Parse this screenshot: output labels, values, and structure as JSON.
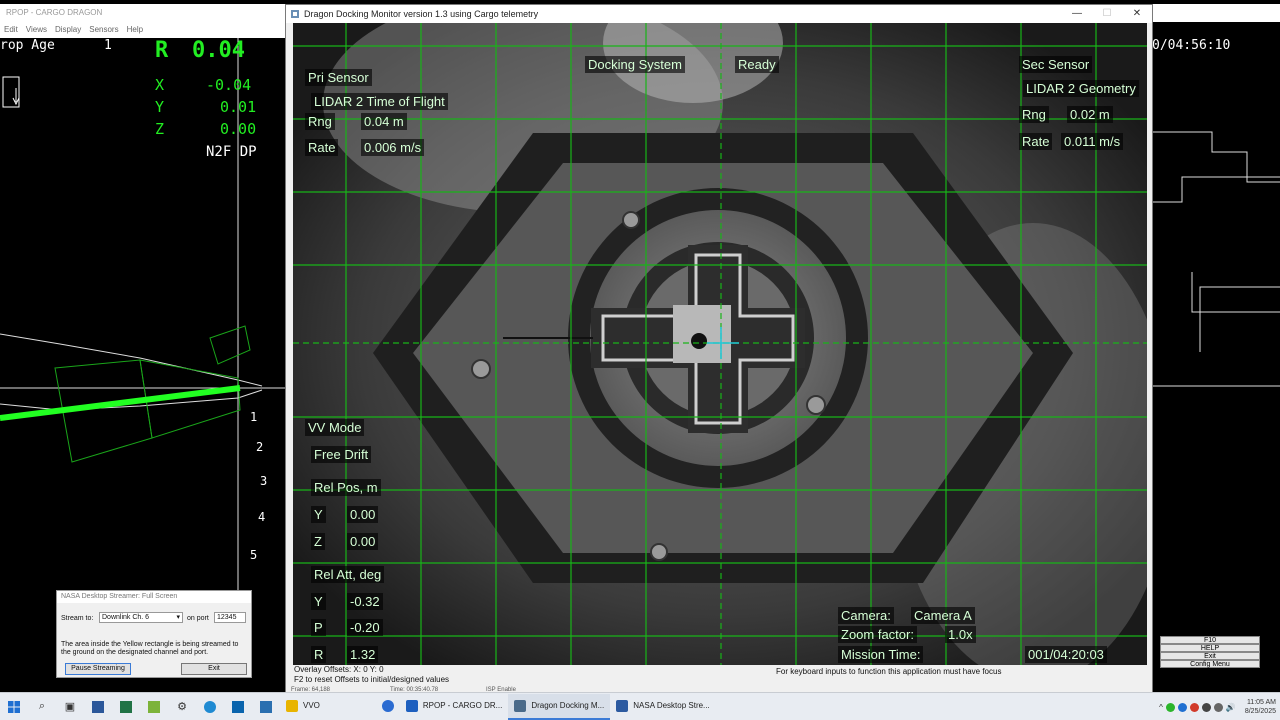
{
  "rpop": {
    "title": "RPOP - CARGO DRAGON",
    "menu": [
      "Edit",
      "Views",
      "Display",
      "Sensors",
      "Help"
    ],
    "prop_age_label": "rop Age",
    "prop_age_value": "1",
    "r_label": "R",
    "r_value": "0.04",
    "x_label": "X",
    "x_value": "-0.04",
    "y_label": "Y",
    "y_value": "0.01",
    "z_label": "Z",
    "z_value": "0.00",
    "mode": "N2F DP",
    "axis_ticks": [
      "1",
      "2",
      "3",
      "4",
      "5"
    ]
  },
  "right_panel": {
    "time": "0/04:56:10",
    "fkeys": [
      "F10",
      "HELP",
      "Exit",
      "Config Menu"
    ]
  },
  "window": {
    "title": "Dragon Docking Monitor version 1.3 using Cargo telemetry",
    "controls": [
      "—",
      "☐",
      "✕"
    ]
  },
  "overlay": {
    "pri_sensor_label": "Pri Sensor",
    "pri_sensor_value": "LIDAR 2 Time of Flight",
    "pri_rng_label": "Rng",
    "pri_rng_value": "0.04 m",
    "pri_rate_label": "Rate",
    "pri_rate_value": "0.006 m/s",
    "docking_system_label": "Docking System",
    "docking_system_value": "Ready",
    "sec_sensor_label": "Sec Sensor",
    "sec_sensor_value": "LIDAR 2 Geometry",
    "sec_rng_label": "Rng",
    "sec_rng_value": "0.02 m",
    "sec_rate_label": "Rate",
    "sec_rate_value": "0.011 m/s",
    "vv_mode_label": "VV Mode",
    "vv_mode_value": "Free Drift",
    "rel_pos_label": "Rel Pos, m",
    "pos_y_label": "Y",
    "pos_y_value": "0.00",
    "pos_z_label": "Z",
    "pos_z_value": "0.00",
    "rel_att_label": "Rel Att, deg",
    "att_y_label": "Y",
    "att_y_value": "-0.32",
    "att_p_label": "P",
    "att_p_value": "-0.20",
    "att_r_label": "R",
    "att_r_value": "1.32",
    "camera_label": "Camera:",
    "camera_value": "Camera A",
    "zoom_label": "Zoom factor:",
    "zoom_value": "1.0x",
    "mission_time_label": "Mission Time:",
    "mission_time_value": "001/04:20:03"
  },
  "status": {
    "overlay_offsets": "Overlay Offsets:  X: 0     Y: 0",
    "reset_hint": "F2 to reset Offsets to initial/designed values",
    "focus_hint": "For keyboard inputs to function this application must have focus",
    "frame": "Frame: 64,188",
    "time": "Time: 00:35:40.78",
    "isp": "ISP Enable"
  },
  "streamer": {
    "title": "NASA Desktop Streamer: Full Screen",
    "stream_to_label": "Stream to:",
    "stream_to_value": "Downlink Ch. 6",
    "port_label": "on port",
    "port_value": "12345",
    "info": "The area inside the Yellow rectangle is being streamed to the ground on the designated channel and port.",
    "pause_button": "Pause Streaming",
    "exit_button": "Exit"
  },
  "taskbar": {
    "apps": [
      {
        "label": "VVO",
        "color": "#e8b400"
      },
      {
        "label": "",
        "color": "#2a6bd1"
      },
      {
        "label": "RPOP - CARGO DR...",
        "color": "#1d5fbf"
      },
      {
        "label": "Dragon Docking M...",
        "color": "#4a6a8a"
      },
      {
        "label": "NASA Desktop Stre...",
        "color": "#2c5aa0"
      }
    ],
    "time": "11:05 AM",
    "date": "8/25/2025"
  }
}
